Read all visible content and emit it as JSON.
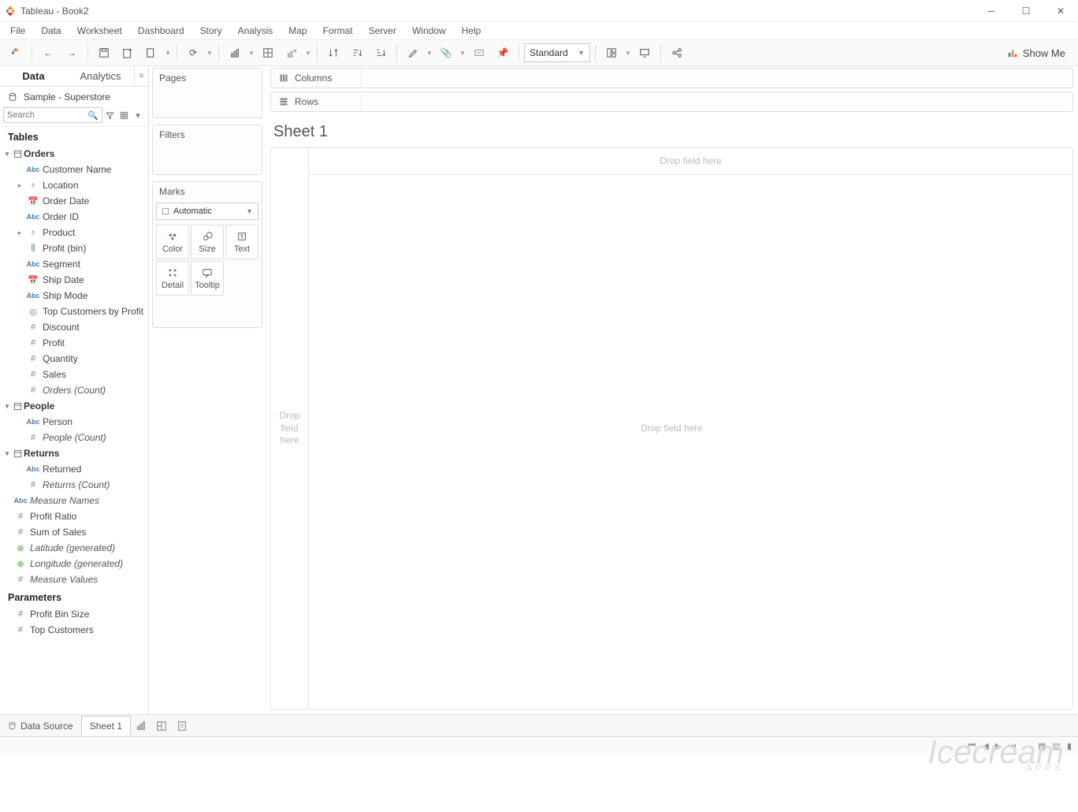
{
  "window": {
    "title": "Tableau - Book2"
  },
  "menu": [
    "File",
    "Data",
    "Worksheet",
    "Dashboard",
    "Story",
    "Analysis",
    "Map",
    "Format",
    "Server",
    "Window",
    "Help"
  ],
  "toolbar": {
    "fit": "Standard",
    "showme": "Show Me"
  },
  "sidebar": {
    "tabs": {
      "data": "Data",
      "analytics": "Analytics"
    },
    "datasource": "Sample - Superstore",
    "search_placeholder": "Search",
    "tables_h": "Tables",
    "params_h": "Parameters",
    "groups": [
      {
        "name": "Orders",
        "expanded": true,
        "fields": [
          {
            "name": "Customer Name",
            "icon": "abc"
          },
          {
            "name": "Location",
            "icon": "geo",
            "expandable": true
          },
          {
            "name": "Order Date",
            "icon": "date"
          },
          {
            "name": "Order ID",
            "icon": "abc"
          },
          {
            "name": "Product",
            "icon": "geo",
            "expandable": true
          },
          {
            "name": "Profit (bin)",
            "icon": "bin"
          },
          {
            "name": "Segment",
            "icon": "abc"
          },
          {
            "name": "Ship Date",
            "icon": "date"
          },
          {
            "name": "Ship Mode",
            "icon": "abc"
          },
          {
            "name": "Top Customers by Profit",
            "icon": "set"
          },
          {
            "name": "Discount",
            "icon": "num"
          },
          {
            "name": "Profit",
            "icon": "num"
          },
          {
            "name": "Quantity",
            "icon": "num"
          },
          {
            "name": "Sales",
            "icon": "num"
          },
          {
            "name": "Orders (Count)",
            "icon": "num",
            "italic": true
          }
        ]
      },
      {
        "name": "People",
        "expanded": true,
        "fields": [
          {
            "name": "Person",
            "icon": "abc"
          },
          {
            "name": "People (Count)",
            "icon": "num",
            "italic": true
          }
        ]
      },
      {
        "name": "Returns",
        "expanded": true,
        "fields": [
          {
            "name": "Returned",
            "icon": "abc"
          },
          {
            "name": "Returns (Count)",
            "icon": "num",
            "italic": true
          }
        ]
      }
    ],
    "loose": [
      {
        "name": "Measure Names",
        "icon": "abc",
        "italic": true
      },
      {
        "name": "Profit Ratio",
        "icon": "num"
      },
      {
        "name": "Sum of Sales",
        "icon": "num"
      },
      {
        "name": "Latitude (generated)",
        "icon": "globe",
        "italic": true
      },
      {
        "name": "Longitude (generated)",
        "icon": "globe",
        "italic": true
      },
      {
        "name": "Measure Values",
        "icon": "num",
        "italic": true
      }
    ],
    "parameters": [
      {
        "name": "Profit Bin Size",
        "icon": "num"
      },
      {
        "name": "Top Customers",
        "icon": "num"
      }
    ]
  },
  "cards": {
    "pages": "Pages",
    "filters": "Filters",
    "marks": "Marks",
    "mark_type": "Automatic",
    "buttons": [
      "Color",
      "Size",
      "Text",
      "Detail",
      "Tooltip"
    ]
  },
  "shelves": {
    "columns": "Columns",
    "rows": "Rows"
  },
  "sheet": {
    "title": "Sheet 1",
    "drop_col": "Drop field here",
    "drop_row": "Drop\nfield\nhere",
    "drop_main": "Drop field here"
  },
  "bottom": {
    "datasource": "Data Source",
    "sheet": "Sheet 1"
  },
  "watermark": {
    "brand": "Icecream",
    "sub": "APPS"
  }
}
